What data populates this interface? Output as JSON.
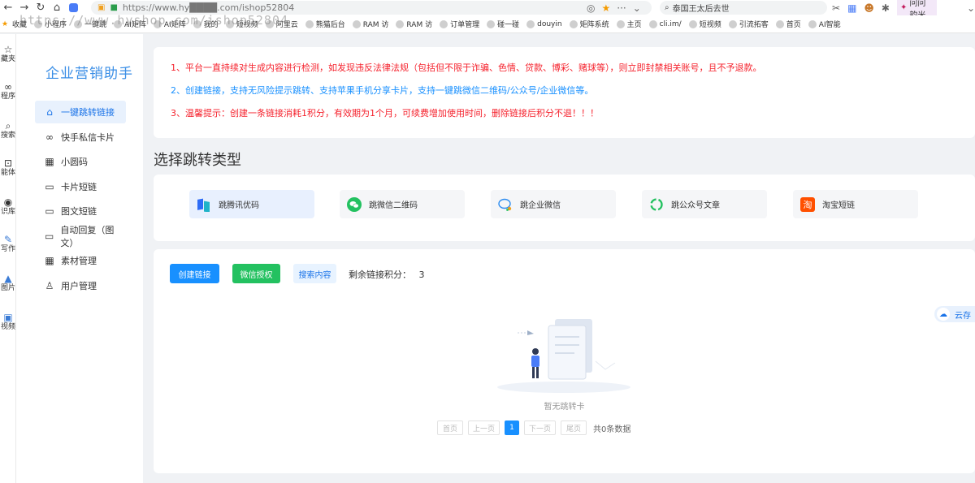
{
  "browser": {
    "url": "https://www.hy████.com/ishop52804",
    "watermark": "https://www.hyshop.com/ishop52804",
    "search_query": "泰国王太后去世",
    "profile_label": "问问韵米",
    "bookmarks": [
      "收藏",
      "小程序",
      "一键跳",
      "AI矩阵",
      "AI矩阵",
      "我的",
      "短视频",
      "阿里云",
      "熊猫后台",
      "RAM 访",
      "RAM 访",
      "订单管理",
      "碰一碰",
      "douyin",
      "矩阵系统",
      "主页",
      "cli.im/",
      "短视频",
      "引流拓客",
      "首页",
      "AI智能"
    ]
  },
  "rail": [
    {
      "icon": "star-icon",
      "label": "藏夹"
    },
    {
      "icon": "link-icon",
      "label": "程序"
    },
    {
      "icon": "search-icon",
      "label": "搜索"
    },
    {
      "icon": "robot-icon",
      "label": "能体"
    },
    {
      "icon": "library-icon",
      "label": "识库"
    },
    {
      "icon": "pen-icon",
      "label": "写作"
    },
    {
      "icon": "image-icon",
      "label": "图片"
    },
    {
      "icon": "video-icon",
      "label": "视频"
    }
  ],
  "app": {
    "brand": "企业营销助手",
    "menu": [
      {
        "label": "一键跳转链接",
        "icon": "home-icon",
        "active": true
      },
      {
        "label": "快手私信卡片",
        "icon": "link-icon"
      },
      {
        "label": "小圆码",
        "icon": "qrcode-icon"
      },
      {
        "label": "卡片短链",
        "icon": "card-icon"
      },
      {
        "label": "图文短链",
        "icon": "card-icon"
      },
      {
        "label": "自动回复（图文）",
        "icon": "card-icon"
      },
      {
        "label": "素材管理",
        "icon": "qrcode-icon"
      },
      {
        "label": "用户管理",
        "icon": "user-icon"
      }
    ]
  },
  "notice": [
    {
      "text": "1、平台一直持续对生成内容进行检测，如发现违反法律法规（包括但不限于诈骗、色情、贷款、博彩、赌球等），则立即封禁相关账号，且不予退款。",
      "color": "#f5222d"
    },
    {
      "text": "2、创建链接，支持无风险提示跳转、支持苹果手机分享卡片，支持一键跳微信二维码/公众号/企业微信等。",
      "color": "#1890ff"
    },
    {
      "text": "3、温馨提示：创建一条链接消耗1积分，有效期为1个月，可续费增加使用时间，删除链接后积分不退！！！",
      "color": "#f5222d"
    }
  ],
  "section_title": "选择跳转类型",
  "jump_types": [
    {
      "label": "跳腾讯优码",
      "icon": "tencent-code-icon",
      "active": true
    },
    {
      "label": "跳微信二维码",
      "icon": "wechat-icon"
    },
    {
      "label": "跳企业微信",
      "icon": "wecom-icon"
    },
    {
      "label": "跳公众号文章",
      "icon": "official-account-icon"
    },
    {
      "label": "淘宝短链",
      "icon": "taobao-icon"
    }
  ],
  "list": {
    "create_label": "创建链接",
    "auth_label": "微信授权",
    "search_label": "搜索内容",
    "points_label": "剩余链接积分：",
    "points_value": "3",
    "empty_text": "暂无跳转卡",
    "pager": {
      "first": "首页",
      "prev": "上一页",
      "current": "1",
      "next": "下一页",
      "last": "尾页",
      "total": "共0条数据"
    }
  },
  "float_tab": "云存",
  "colors": {
    "primary": "#1890ff",
    "green": "#23c160",
    "danger": "#f5222d",
    "brand": "#3a8ee6"
  }
}
